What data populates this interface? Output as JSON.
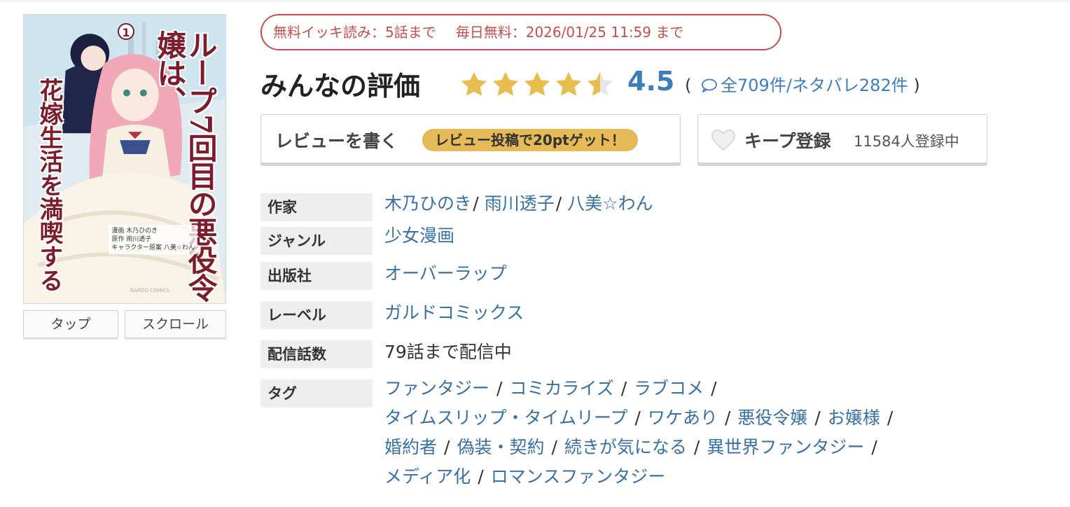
{
  "cover": {
    "title": "ループ7回目の悪役令嬢は、",
    "subtitle": "花嫁生活を満喫する",
    "volume": "1",
    "credits": [
      "漫画 木乃ひのき",
      "原作 雨川透子",
      "キャラクター原案 八美☆わん"
    ],
    "imprint": "GARDO COMICS"
  },
  "view_buttons": {
    "tap": "タップ",
    "scroll": "スクロール"
  },
  "free_info": {
    "ikki": "無料イッキ読み：5話まで",
    "daily": "毎日無料：2026/01/25 11:59 まで"
  },
  "rating": {
    "title": "みんなの評価",
    "value": "4.5",
    "stars": 4.5,
    "open_paren": "(",
    "counts": "全709件/ネタバレ282件",
    "close_paren": ")",
    "star_color": "#e8bd4f",
    "accent": "#3e7dbb"
  },
  "review_button": {
    "label": "レビューを書く",
    "bonus": "レビュー投稿で20ptゲット！"
  },
  "keep_button": {
    "label": "キープ登録",
    "count": "11584人登録中"
  },
  "info": {
    "author_label": "作家",
    "authors": [
      "木乃ひのき",
      "雨川透子",
      "八美☆わん"
    ],
    "genre_label": "ジャンル",
    "genre": "少女漫画",
    "publisher_label": "出版社",
    "publisher": "オーバーラップ",
    "label_label": "レーベル",
    "label": "ガルドコミックス",
    "episodes_label": "配信話数",
    "episodes": "79話まで配信中",
    "tags_label": "タグ",
    "tags": [
      "ファンタジー",
      "コミカライズ",
      "ラブコメ",
      "タイムスリップ・タイムリープ",
      "ワケあり",
      "悪役令嬢",
      "お嬢様",
      "婚約者",
      "偽装・契約",
      "続きが気になる",
      "異世界ファンタジー",
      "メディア化",
      "ロマンスファンタジー"
    ],
    "separator": "/"
  }
}
